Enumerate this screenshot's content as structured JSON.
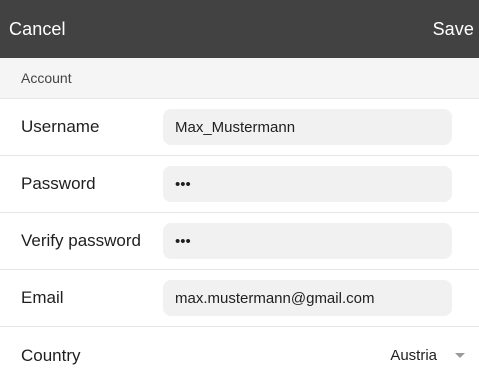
{
  "topbar": {
    "cancel_label": "Cancel",
    "save_label": "Save"
  },
  "section": {
    "title": "Account"
  },
  "fields": {
    "username": {
      "label": "Username",
      "value": "Max_Mustermann"
    },
    "password": {
      "label": "Password",
      "value": "•••"
    },
    "verify_password": {
      "label": "Verify password",
      "value": "•••"
    },
    "email": {
      "label": "Email",
      "value": "max.mustermann@gmail.com"
    },
    "country": {
      "label": "Country",
      "value": "Austria"
    }
  },
  "colors": {
    "topbar_bg": "#424242",
    "section_bg": "#f5f5f5",
    "input_bg": "#f1f1f1"
  }
}
